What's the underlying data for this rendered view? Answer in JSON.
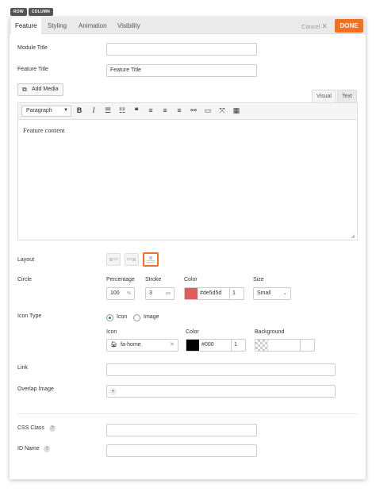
{
  "breadcrumbs": [
    "ROW",
    "COLUMN"
  ],
  "tabs": [
    {
      "label": "Feature"
    },
    {
      "label": "Styling"
    },
    {
      "label": "Animation"
    },
    {
      "label": "Visibility"
    }
  ],
  "actions": {
    "cancel": "Cancel",
    "done": "DONE"
  },
  "fields": {
    "module_title": {
      "label": "Module Title",
      "value": ""
    },
    "feature_title": {
      "label": "Feature Title",
      "value": "Feature Title"
    }
  },
  "editor": {
    "add_media": "Add Media",
    "tab_visual": "Visual",
    "tab_text": "Text",
    "format": "Paragraph",
    "content": "Feature content",
    "toolbar_icons": [
      "bold-icon",
      "italic-icon",
      "bullet-list-icon",
      "numbered-list-icon",
      "blockquote-icon",
      "align-left-icon",
      "align-center-icon",
      "align-right-icon",
      "link-icon",
      "read-more-icon",
      "fullscreen-icon",
      "toolbar-toggle-icon"
    ]
  },
  "layout": {
    "label": "Layout",
    "options": [
      "icon-left-layout",
      "icon-right-layout",
      "icon-top-layout"
    ],
    "selected": 2
  },
  "circle": {
    "label": "Circle",
    "percentage_label": "Percentage",
    "percentage_value": "100",
    "percentage_unit": "%",
    "stroke_label": "Stroke",
    "stroke_value": "3",
    "stroke_unit": "px",
    "color_label": "Color",
    "color_value": "#de5d5d",
    "color_opacity": "1",
    "color_swatch": "#de5d5d",
    "size_label": "Size",
    "size_value": "Small"
  },
  "icon_type": {
    "label": "Icon Type",
    "opt_icon": "Icon",
    "opt_image": "Image",
    "icon_label": "Icon",
    "icon_value": "fa-home",
    "color_label": "Color",
    "color_value": "#000",
    "color_opacity": "1",
    "color_swatch": "#000000",
    "bg_label": "Background",
    "bg_value": ""
  },
  "link": {
    "label": "Link",
    "value": ""
  },
  "overlap_image": {
    "label": "Overlap Image",
    "value": ""
  },
  "css_class": {
    "label": "CSS Class",
    "value": ""
  },
  "id_name": {
    "label": "ID Name",
    "value": ""
  }
}
